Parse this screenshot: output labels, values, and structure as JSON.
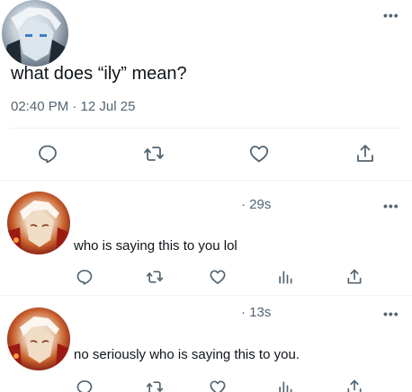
{
  "main_post": {
    "text": "what does “ily” mean?",
    "timestamp": "02:40 PM · 12 Jul 25",
    "more_label": "•••",
    "actions": [
      "reply-icon",
      "repost-icon",
      "like-icon",
      "share-icon"
    ]
  },
  "replies": [
    {
      "time": "· 29s",
      "text": "who is saying this to you lol",
      "more_label": "•••",
      "actions": [
        "reply-icon",
        "repost-icon",
        "like-icon",
        "views-icon",
        "share-icon"
      ]
    },
    {
      "time": "· 13s",
      "text": "no seriously who is saying this to you.",
      "more_label": "•••",
      "actions": [
        "reply-icon",
        "repost-icon",
        "like-icon",
        "views-icon",
        "share-icon"
      ]
    }
  ],
  "colors": {
    "text": "#0f1419",
    "secondary": "#536471",
    "icon": "#536471",
    "divider": "#eff3f4",
    "background": "#ffffff"
  }
}
